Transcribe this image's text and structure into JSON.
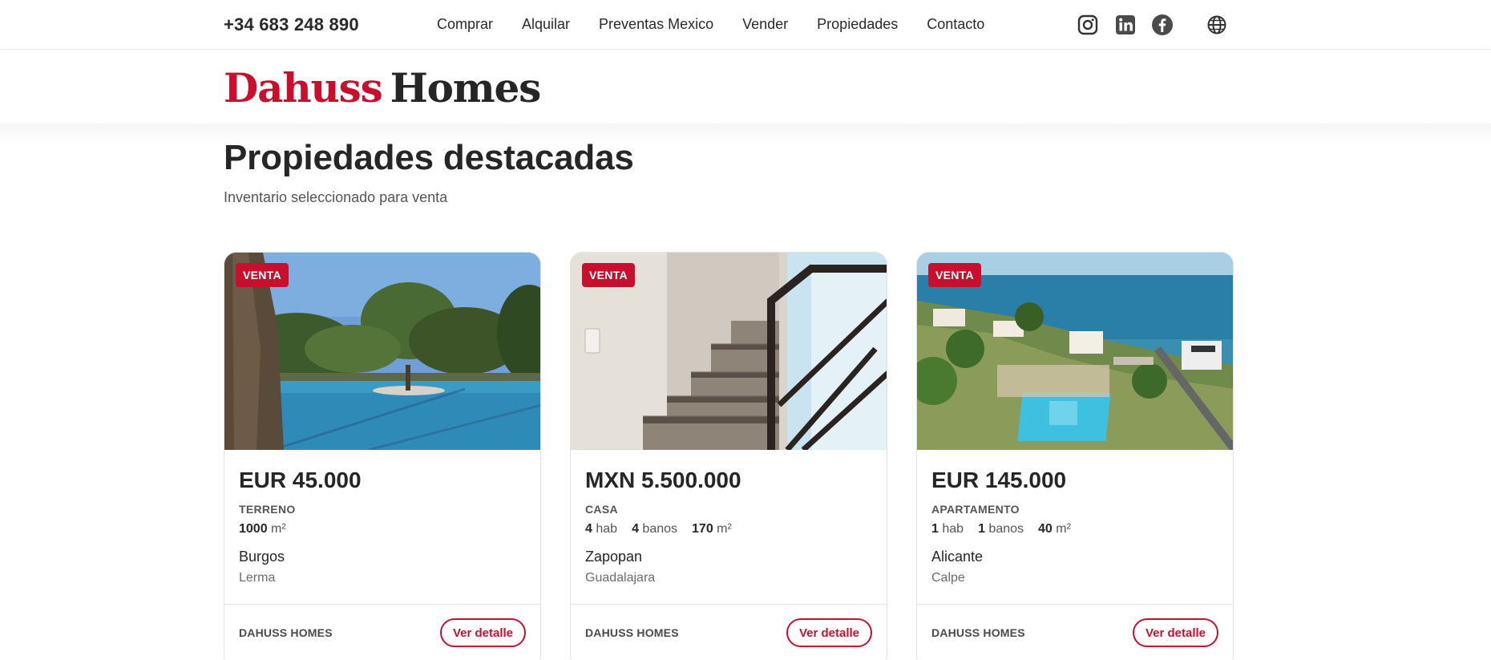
{
  "header": {
    "phone": "+34 683 248 890",
    "nav": [
      "Comprar",
      "Alquilar",
      "Preventas Mexico",
      "Vender",
      "Propiedades",
      "Contacto"
    ],
    "social_icons": [
      "instagram-icon",
      "linkedin-icon",
      "facebook-icon",
      "globe-icon"
    ]
  },
  "logo": {
    "part1": "Dahuss",
    "part2": "Homes"
  },
  "main": {
    "title": "Propiedades destacadas",
    "subtitle": "Inventario seleccionado para venta"
  },
  "cards": [
    {
      "badge": "VENTA",
      "price": "EUR 45.000",
      "type": "TERRENO",
      "area_value": "1000",
      "area_unit": "m²",
      "city": "Burgos",
      "zone": "Lerma",
      "agency": "DAHUSS HOMES",
      "cta": "Ver detalle"
    },
    {
      "badge": "VENTA",
      "price": "MXN 5.500.000",
      "type": "CASA",
      "rooms_value": "4",
      "rooms_unit": "hab",
      "baths_value": "4",
      "baths_unit": "banos",
      "area_value": "170",
      "area_unit": "m²",
      "city": "Zapopan",
      "zone": "Guadalajara",
      "agency": "DAHUSS HOMES",
      "cta": "Ver detalle"
    },
    {
      "badge": "VENTA",
      "price": "EUR 145.000",
      "type": "APARTAMENTO",
      "rooms_value": "1",
      "rooms_unit": "hab",
      "baths_value": "1",
      "baths_unit": "banos",
      "area_value": "40",
      "area_unit": "m²",
      "city": "Alicante",
      "zone": "Calpe",
      "agency": "DAHUSS HOMES",
      "cta": "Ver detalle"
    }
  ],
  "colors": {
    "accent": "#c8102e",
    "text": "#262626",
    "muted": "#555555"
  }
}
